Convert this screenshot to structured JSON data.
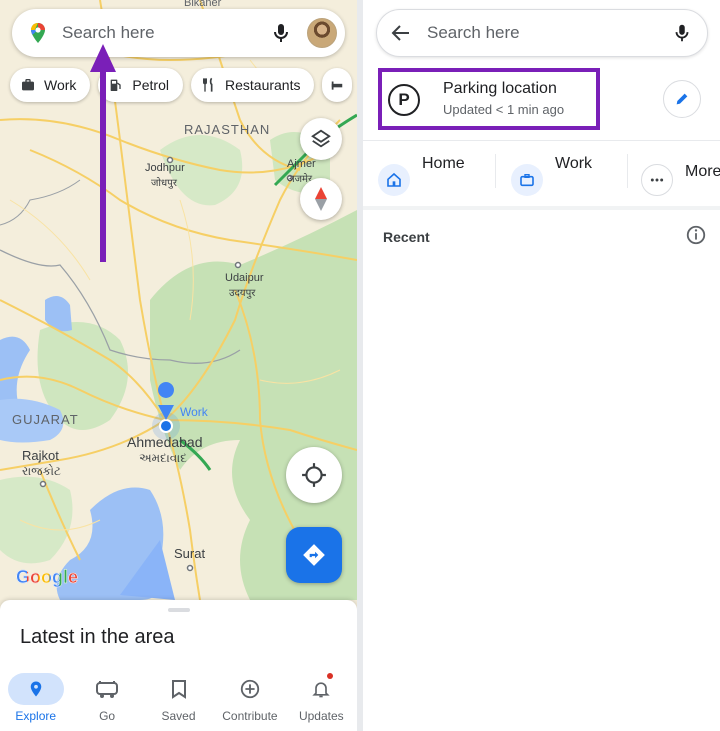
{
  "left": {
    "search": {
      "placeholder": "Search here"
    },
    "chips": [
      {
        "label": "Work",
        "icon": "briefcase-icon"
      },
      {
        "label": "Petrol",
        "icon": "fuel-icon"
      },
      {
        "label": "Restaurants",
        "icon": "fork-knife-icon"
      }
    ],
    "map_labels": {
      "bikaner": "Bikaner",
      "rajasthan": "RAJASTHAN",
      "jodhpur": "Jodhpur",
      "jodhpur_local": "जोधपुर",
      "ajmer": "Ajmer",
      "ajmer_local": "अजमेर",
      "udaipur": "Udaipur",
      "udaipur_local": "उदयपुर",
      "gujarat": "GUJARAT",
      "work": "Work",
      "ahmedabad": "Ahmedabad",
      "ahmedabad_local": "અમદાવાદ",
      "rajkot": "Rajkot",
      "rajkot_local": "રાજકોટ",
      "surat": "Surat"
    },
    "google_logo": "Google",
    "sheet_title": "Latest in the area",
    "nav": [
      {
        "label": "Explore",
        "icon": "location-pin-icon",
        "active": true
      },
      {
        "label": "Go",
        "icon": "car-icon",
        "active": false
      },
      {
        "label": "Saved",
        "icon": "bookmark-icon",
        "active": false
      },
      {
        "label": "Contribute",
        "icon": "add-circle-icon",
        "active": false
      },
      {
        "label": "Updates",
        "icon": "bell-icon",
        "active": false
      }
    ]
  },
  "right": {
    "search": {
      "placeholder": "Search here"
    },
    "parking": {
      "title": "Parking location",
      "subtitle": "Updated < 1 min ago"
    },
    "places": [
      {
        "label": "Home",
        "icon": "home-icon"
      },
      {
        "label": "Work",
        "icon": "briefcase-icon"
      },
      {
        "label": "More",
        "icon": "more-dots-icon"
      }
    ],
    "recent_label": "Recent"
  },
  "colors": {
    "accent_blue": "#1a73e8",
    "annotation_purple": "#7a1fb8",
    "map_green": "#c2dfb2",
    "map_water": "#8ab4f8",
    "road_yellow": "#f7d26b"
  }
}
